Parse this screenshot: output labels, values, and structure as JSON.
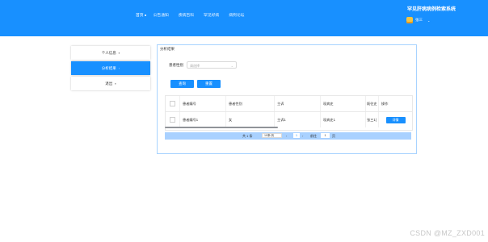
{
  "header": {
    "nav": [
      "首页",
      "公告通知",
      "疾病百科",
      "罕见好病",
      "病例论坛"
    ],
    "site_title": "罕见肝病病例检索系统",
    "user_name": "张三"
  },
  "sidebar": {
    "items": [
      {
        "label": "个人信息",
        "icon": "user-icon"
      },
      {
        "label": "分析结果",
        "icon": "chart-icon",
        "active": true
      },
      {
        "label": "退出",
        "icon": "logout-icon"
      }
    ]
  },
  "panel": {
    "title": "分析结果",
    "filter": {
      "label": "患者性别",
      "placeholder": "请选择"
    },
    "buttons": {
      "search": "查询",
      "reset": "重置"
    },
    "table": {
      "headers": [
        "患者编号",
        "患者性别",
        "主诉",
        "现病史",
        "既往史",
        "操作"
      ],
      "rows": [
        [
          "患者编号1",
          "女",
          "主诉1",
          "现病史1",
          "张三1(",
          "详情"
        ]
      ]
    },
    "pagination": {
      "total": "共 1 条",
      "page_size": "10条/页",
      "current": "1",
      "goto": "前往",
      "goto_value": "1",
      "unit": "页"
    }
  },
  "watermark": "CSDN @MZ_ZXD001"
}
